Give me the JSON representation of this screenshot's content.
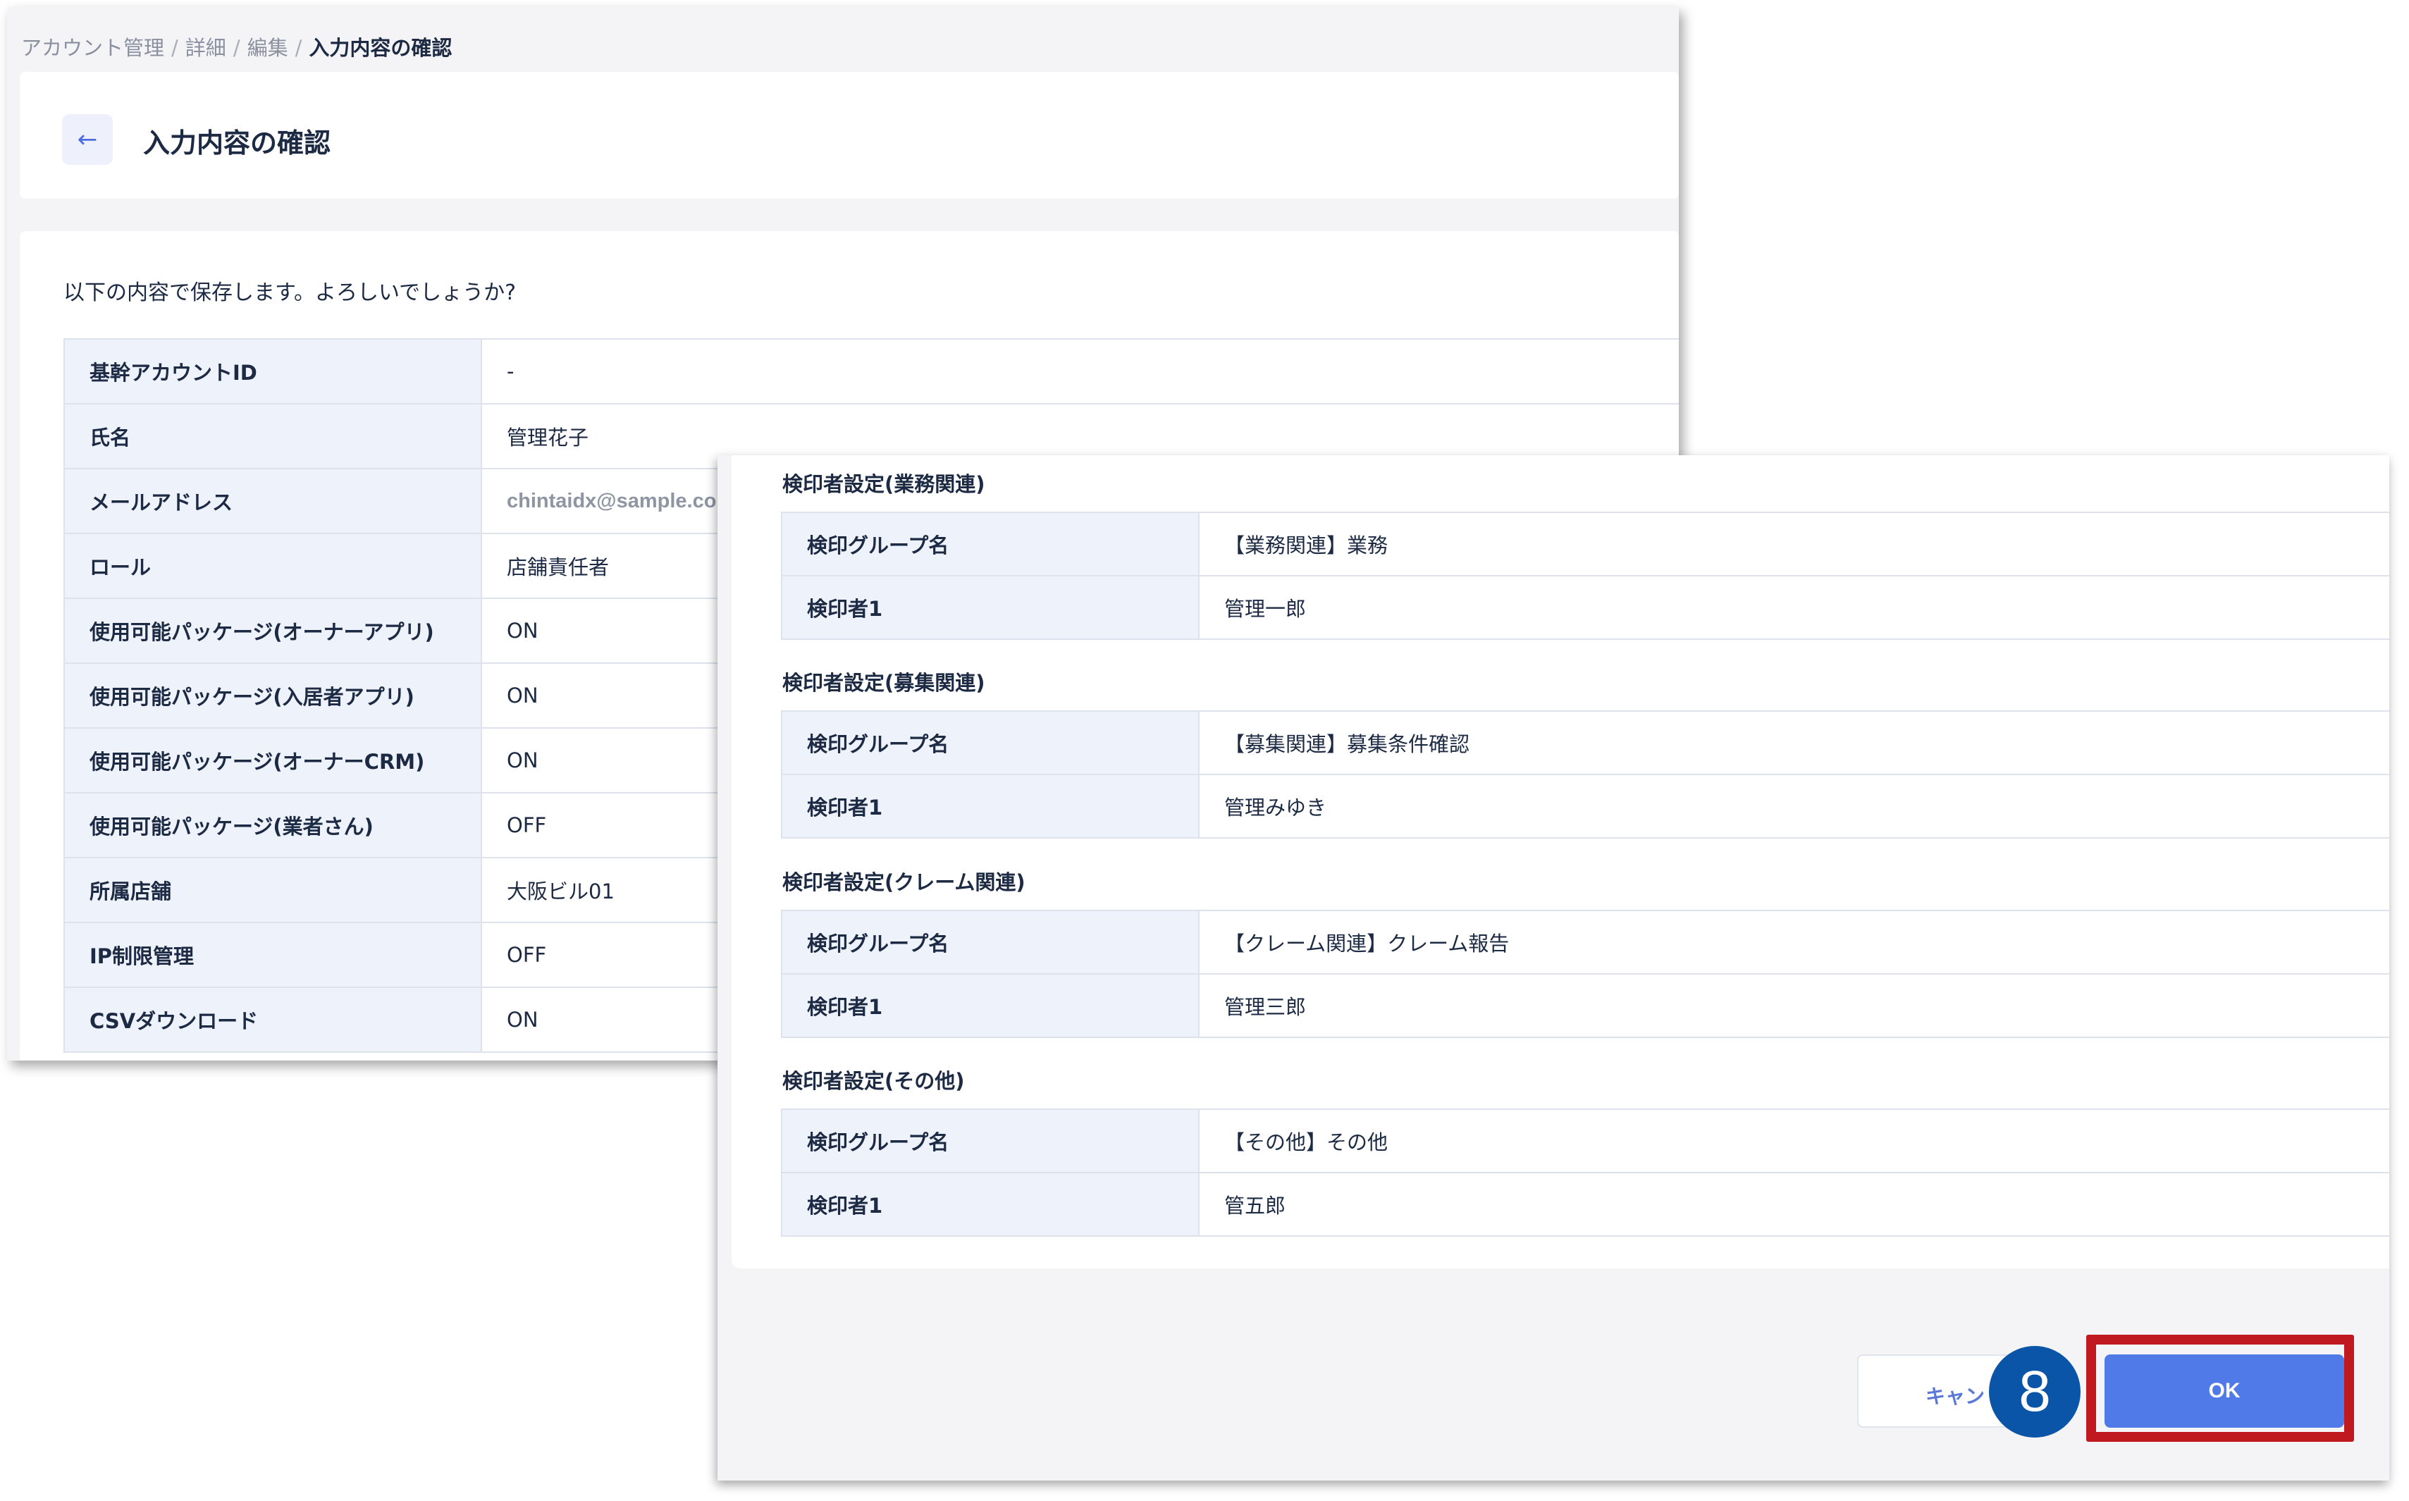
{
  "breadcrumb": {
    "items": [
      "アカウント管理",
      "詳細",
      "編集"
    ],
    "current": "入力内容の確認",
    "separator": "/"
  },
  "header": {
    "back_icon": "arrow-left-icon",
    "back_glyph": "←",
    "title": "入力内容の確認"
  },
  "intro": "以下の内容で保存します。よろしいでしょうか?",
  "fields": [
    {
      "label": "基幹アカウントID",
      "value": "-"
    },
    {
      "label": "氏名",
      "value": "管理花子"
    },
    {
      "label": "メールアドレス",
      "value": "chintaidx@sample.com"
    },
    {
      "label": "ロール",
      "value": "店舗責任者"
    },
    {
      "label": "使用可能パッケージ(オーナーアプリ)",
      "value": "ON"
    },
    {
      "label": "使用可能パッケージ(入居者アプリ)",
      "value": "ON"
    },
    {
      "label": "使用可能パッケージ(オーナーCRM)",
      "value": "ON"
    },
    {
      "label": "使用可能パッケージ(業者さん)",
      "value": "OFF"
    },
    {
      "label": "所属店舗",
      "value": "大阪ビル01"
    },
    {
      "label": "IP制限管理",
      "value": "OFF"
    },
    {
      "label": "CSVダウンロード",
      "value": "ON"
    }
  ],
  "approver_sections": [
    {
      "title": "検印者設定(業務関連)",
      "rows": [
        {
          "label": "検印グループ名",
          "value": "【業務関連】業務"
        },
        {
          "label": "検印者1",
          "value": "管理一郎"
        }
      ]
    },
    {
      "title": "検印者設定(募集関連)",
      "rows": [
        {
          "label": "検印グループ名",
          "value": "【募集関連】募集条件確認"
        },
        {
          "label": "検印者1",
          "value": "管理みゆき"
        }
      ]
    },
    {
      "title": "検印者設定(クレーム関連)",
      "rows": [
        {
          "label": "検印グループ名",
          "value": "【クレーム関連】クレーム報告"
        },
        {
          "label": "検印者1",
          "value": "管理三郎"
        }
      ]
    },
    {
      "title": "検印者設定(その他)",
      "rows": [
        {
          "label": "検印グループ名",
          "value": "【その他】その他"
        },
        {
          "label": "検印者1",
          "value": "管五郎"
        }
      ]
    }
  ],
  "actions": {
    "cancel_label": "キャン",
    "ok_label": "OK"
  },
  "annotation": {
    "step_number": "8",
    "highlight_color": "#c0191f",
    "badge_color": "#0a55a8"
  },
  "colors": {
    "accent": "#4f7ae8",
    "label_bg": "#eef2fb",
    "border": "#dde2ec"
  }
}
